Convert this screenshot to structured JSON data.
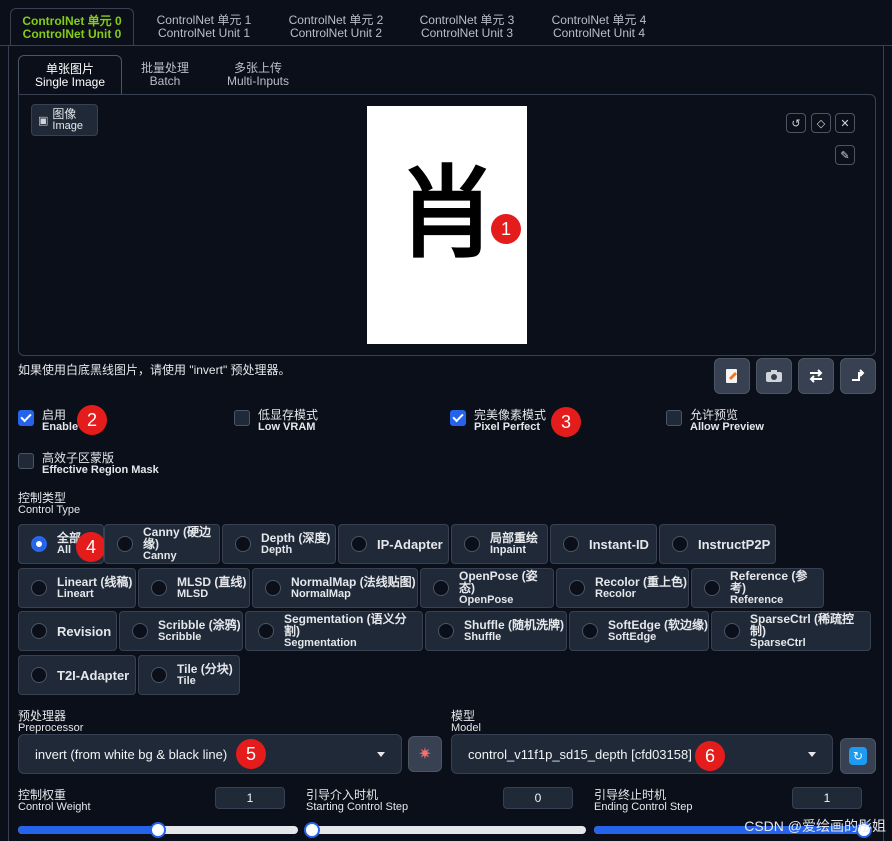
{
  "unit_tabs": [
    {
      "zh": "ControlNet 单元 0",
      "en": "ControlNet Unit 0"
    },
    {
      "zh": "ControlNet 单元 1",
      "en": "ControlNet Unit 1"
    },
    {
      "zh": "ControlNet 单元 2",
      "en": "ControlNet Unit 2"
    },
    {
      "zh": "ControlNet 单元 3",
      "en": "ControlNet Unit 3"
    },
    {
      "zh": "ControlNet 单元 4",
      "en": "ControlNet Unit 4"
    }
  ],
  "input_tabs": [
    {
      "zh": "单张图片",
      "en": "Single Image"
    },
    {
      "zh": "批量处理",
      "en": "Batch"
    },
    {
      "zh": "多张上传",
      "en": "Multi-Inputs"
    }
  ],
  "image_label": {
    "zh": "图像",
    "en": "Image"
  },
  "image_glyph": "肖",
  "hint": "如果使用白底黑线图片，请使用 \"invert\" 预处理器。",
  "markers": [
    "1",
    "2",
    "3",
    "4",
    "5",
    "6"
  ],
  "checkboxes": {
    "enable": {
      "zh": "启用",
      "en": "Enable",
      "checked": true
    },
    "low_vram": {
      "zh": "低显存模式",
      "en": "Low VRAM",
      "checked": false
    },
    "pixel_perfect": {
      "zh": "完美像素模式",
      "en": "Pixel Perfect",
      "checked": true
    },
    "allow_preview": {
      "zh": "允许预览",
      "en": "Allow Preview",
      "checked": false
    },
    "region_mask": {
      "zh": "高效子区蒙版",
      "en": "Effective Region Mask",
      "checked": false
    }
  },
  "control_type": {
    "zh": "控制类型",
    "en": "Control Type",
    "selected": "All",
    "options": [
      {
        "zh": "全部",
        "en": "All"
      },
      {
        "zh": "Canny (硬边缘)",
        "en": "Canny"
      },
      {
        "zh": "Depth (深度)",
        "en": "Depth"
      },
      {
        "single": "IP-Adapter"
      },
      {
        "zh": "局部重绘",
        "en": "Inpaint"
      },
      {
        "single": "Instant-ID"
      },
      {
        "single": "InstructP2P"
      },
      {
        "zh": "Lineart (线稿)",
        "en": "Lineart"
      },
      {
        "zh": "MLSD (直线)",
        "en": "MLSD"
      },
      {
        "zh": "NormalMap (法线贴图)",
        "en": "NormalMap"
      },
      {
        "zh": "OpenPose (姿态)",
        "en": "OpenPose"
      },
      {
        "zh": "Recolor (重上色)",
        "en": "Recolor"
      },
      {
        "zh": "Reference (参考)",
        "en": "Reference"
      },
      {
        "single": "Revision"
      },
      {
        "zh": "Scribble (涂鸦)",
        "en": "Scribble"
      },
      {
        "zh": "Segmentation (语义分割)",
        "en": "Segmentation"
      },
      {
        "zh": "Shuffle (随机洗牌)",
        "en": "Shuffle"
      },
      {
        "zh": "SoftEdge (软边缘)",
        "en": "SoftEdge"
      },
      {
        "zh": "SparseCtrl (稀疏控制)",
        "en": "SparseCtrl"
      },
      {
        "single": "T2I-Adapter"
      },
      {
        "zh": "Tile (分块)",
        "en": "Tile"
      }
    ]
  },
  "preprocessor": {
    "zh": "预处理器",
    "en": "Preprocessor",
    "value": "invert (from white bg & black line)"
  },
  "model": {
    "zh": "模型",
    "en": "Model",
    "value": "control_v11f1p_sd15_depth [cfd03158]"
  },
  "weights": {
    "control_weight": {
      "zh": "控制权重",
      "en": "Control Weight",
      "value": "1",
      "fraction": 0.5
    },
    "start_step": {
      "zh": "引导介入时机",
      "en": "Starting Control Step",
      "value": "0",
      "fraction": 0.0
    },
    "end_step": {
      "zh": "引导终止时机",
      "en": "Ending Control Step",
      "value": "1",
      "fraction": 1.0
    }
  },
  "watermark": "CSDN @爱绘画的彤姐",
  "colors": {
    "accent": "#2563eb",
    "active_tab": "#84cc16",
    "marker": "#e41c1c"
  }
}
